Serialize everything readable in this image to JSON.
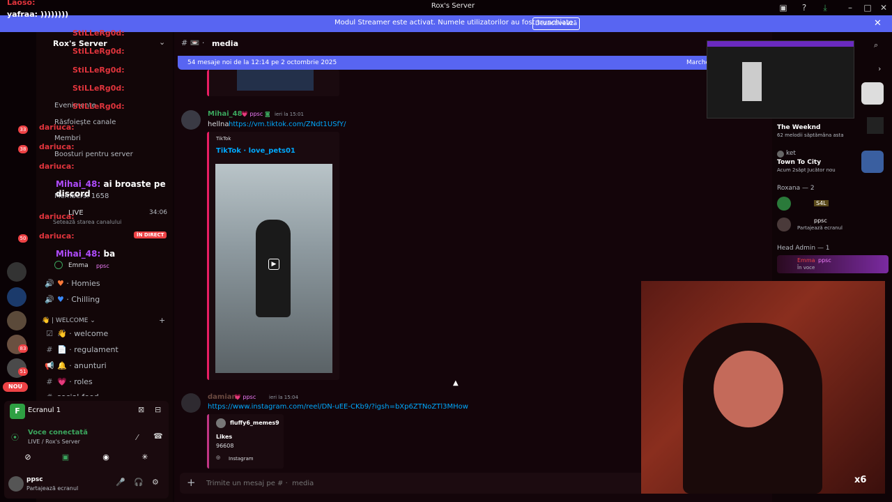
{
  "window": {
    "title": "Rox's Server"
  },
  "banner": {
    "text": "Modul Streamer este activat. Numele utilizatorilor au fost trunchiate.",
    "button": "Dezactivează"
  },
  "server": {
    "name": "Rox's Server"
  },
  "sidebar": {
    "menu": [
      "Evenimente",
      "Răsfoiește canale",
      "Membri",
      "Boosturi pentru server"
    ],
    "members_count": "Members: 1658",
    "live_channel": "LIVE",
    "live_time": "34:06",
    "live_status": "Setează starea canalului",
    "live_badge": "ÎN DIRECT",
    "voice_user": "Emma",
    "voice_badge": "ppsc",
    "channels_voice": [
      "Homies",
      "Chilling"
    ],
    "category": "| WELCOME",
    "channels": [
      "welcome",
      "regulament",
      "anunturi",
      "roles",
      "social-feed"
    ]
  },
  "voice": {
    "screen": "Ecranul 1",
    "connected": "Voce conectată",
    "location": "LIVE / Rox's Server"
  },
  "user": {
    "name": "ppsc",
    "status": "Partajează ecranul"
  },
  "chat": {
    "channel": "media",
    "new_messages": "54 mesaje noi de la 12:14 pe 2 octombrie 2025",
    "mark_read": "Marchează ca citit",
    "messages": [
      {
        "author": "Mihai_48",
        "badge": "ppsc",
        "time": "ieri la 15:01",
        "text": "hellna",
        "link": "https://vm.tiktok.com/ZNdt1USfY/",
        "embed_site": "TikTok",
        "embed_title": "TikTok · love_pets01"
      },
      {
        "author": "damian",
        "badge": "ppsc",
        "time": "ieri la 15:04",
        "link": "https://www.instagram.com/reel/DN-uEE-CKb9/?igsh=bXp6ZTNoZTl3MHow",
        "embed_author": "fluffy6_memes9",
        "embed_likes_label": "Likes",
        "embed_likes": "96608",
        "embed_site": "Instagram"
      }
    ],
    "composer_placeholder": "Trimite un mesaj pe # ·  media"
  },
  "members": {
    "activities": [
      {
        "title": "The Weeknd",
        "sub": "62 melodii săptămâna asta"
      },
      {
        "name": "ket",
        "title": "Town To City",
        "sub": "Acum 2săpt  Jucător nou"
      }
    ],
    "groups": [
      {
        "label": "Roxana — 2",
        "users": [
          {
            "name": "S4L"
          },
          {
            "name": "ppsc",
            "status": "Partajează ecranul"
          }
        ]
      },
      {
        "label": "Head Admin — 1",
        "users": [
          {
            "name": "Emma",
            "badge": "ppsc",
            "status": "În voce"
          }
        ]
      }
    ]
  },
  "overlay": {
    "lines": [
      {
        "user": "yafraa:",
        "text": "))))))))"
      },
      {
        "user": "StiLLeRg0d:",
        "text": ""
      },
      {
        "user": "StiLLeRg0d:",
        "text": ""
      },
      {
        "user": "StiLLeRg0d:",
        "text": ""
      },
      {
        "user": "StiLLeRg0d:",
        "text": ""
      },
      {
        "user": "StiLLeRg0d:",
        "text": ""
      },
      {
        "user": "dariuca:",
        "text": ""
      },
      {
        "user": "dariuca:",
        "text": ""
      },
      {
        "user": "dariuca:",
        "text": ""
      },
      {
        "user": "Mihai_48:",
        "text": "ai broaste pe discord"
      },
      {
        "user": "dariuca:",
        "text": ""
      },
      {
        "user": "dariuca:",
        "text": ""
      },
      {
        "user": "Mihai_48:",
        "text": "ba"
      }
    ],
    "new_badge": "NOU",
    "rail_badges": [
      "33",
      "38",
      "50",
      "83",
      "51"
    ],
    "cam_multiplier": "x6"
  },
  "colors": {
    "accent": "#5865f2",
    "live": "#ed4245",
    "link": "#00a8fc",
    "overlay_user": "#b04cff",
    "overlay_red": "#e0343c"
  }
}
